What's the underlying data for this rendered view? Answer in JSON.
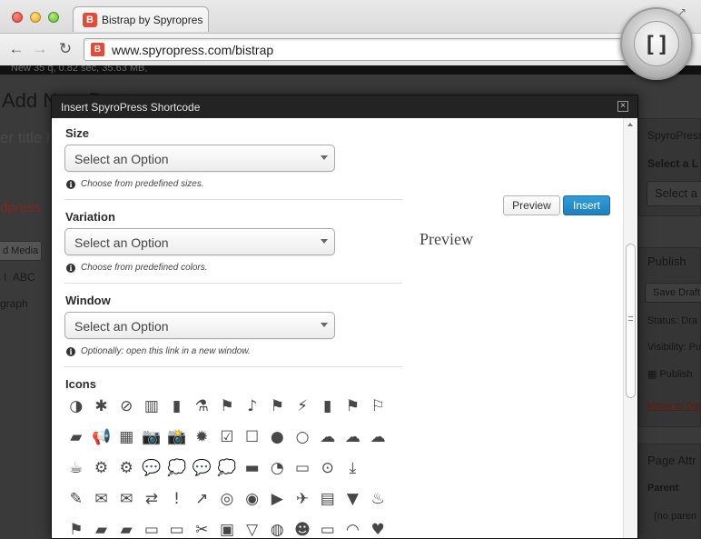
{
  "browser": {
    "tab_title": "Bistrap by Spyropress",
    "url": "www.spyropress.com/bistrap",
    "favicon_letter": "B",
    "extension_glyph": "[]"
  },
  "wp_background": {
    "adminbar_text": "New      35 q, 0.82 sec, 35.63 MB,",
    "heading": "Add New Post",
    "title_placeholder": "er title here",
    "red_text": "dpress",
    "add_media": "d Media",
    "paragraph": "graph",
    "sidebar": {
      "spyropress": "SpyroPress",
      "select_layout": "Select a L",
      "select_placeholder": "Select a",
      "publish": "Publish",
      "save_draft": "Save Draft",
      "status": "Status: Dra",
      "visibility": "Visibility: Pu",
      "publish_date": "Publish",
      "move_to_trash": "Move to Tra",
      "page_attributes": "Page Attr",
      "parent": "Parent",
      "no_parent": "(no paren"
    }
  },
  "modal": {
    "title": "Insert SpyroPress Shortcode",
    "fields": [
      {
        "label": "Size",
        "placeholder": "Select an Option",
        "help": "Choose from predefined sizes."
      },
      {
        "label": "Variation",
        "placeholder": "Select an Option",
        "help": "Choose from predefined colors."
      },
      {
        "label": "Window",
        "placeholder": "Select an Option",
        "help": "Optionally: open this link in a new window."
      }
    ],
    "icons_label": "Icons",
    "buttons": {
      "preview": "Preview",
      "insert": "Insert"
    },
    "preview_heading": "Preview",
    "icons": [
      [
        "adjust-icon",
        "asterisk-icon",
        "ban-icon",
        "bar-chart-icon",
        "barcode-icon",
        "beaker-icon",
        "bullhorn-icon",
        "bell-icon",
        "bell-solid-icon",
        "bolt-icon",
        "book-icon",
        "bookmark-icon",
        "bookmark-empty-icon"
      ],
      [
        "briefcase-icon",
        "bullhorn-solid-icon",
        "calendar-icon",
        "camera-icon",
        "camera-retro-icon",
        "certificate-icon",
        "check-icon",
        "check-empty-icon",
        "circle-icon",
        "circle-blank-icon",
        "cloud-icon",
        "cloud-download-icon",
        "cloud-upload-icon"
      ],
      [
        "coffee-icon",
        "cog-icon",
        "cogs-icon",
        "comment-icon",
        "comment-alt-icon",
        "comments-icon",
        "comments-alt-icon",
        "credit-card-icon",
        "dashboard-icon",
        "desktop-icon",
        "download-icon",
        "download-alt-icon"
      ],
      [
        "edit-icon",
        "envelope-alt-icon",
        "envelope-icon",
        "exchange-icon",
        "exclamation-sign-icon",
        "external-link-icon",
        "eye-close-icon",
        "eye-open-icon",
        "facetime-video-icon",
        "fighter-jet-icon",
        "film-icon",
        "filter-icon",
        "fire-icon"
      ],
      [
        "flag-icon",
        "folder-close-icon",
        "folder-open-icon",
        "folder-close-alt-icon",
        "folder-open-alt-icon",
        "food-icon",
        "gift-icon",
        "glass-icon",
        "globe-icon",
        "group-icon",
        "hdd-icon",
        "headphones-icon",
        "heart-icon"
      ]
    ],
    "icon_glyphs": [
      [
        "◑",
        "✱",
        "⊘",
        "▥",
        "▮",
        "⚗",
        "⚑",
        "♪",
        "⚑",
        "⚡",
        "▮",
        "⚑",
        "⚐"
      ],
      [
        "▰",
        "📢",
        "▦",
        "📷",
        "📸",
        "✹",
        "☑",
        "☐",
        "●",
        "○",
        "☁",
        "☁",
        "☁"
      ],
      [
        "☕",
        "⚙",
        "⚙",
        "💬",
        "💭",
        "💬",
        "💭",
        "▬",
        "◔",
        "▭",
        "⊙",
        "⤓"
      ],
      [
        "✎",
        "✉",
        "✉",
        "⇄",
        "!",
        "↗",
        "◎",
        "◉",
        "▶",
        "✈",
        "▤",
        "▼",
        "♨"
      ],
      [
        "⚑",
        "▰",
        "▰",
        "▭",
        "▭",
        "✂",
        "▣",
        "▽",
        "◍",
        "☻",
        "▭",
        "◠",
        "♥"
      ]
    ]
  }
}
